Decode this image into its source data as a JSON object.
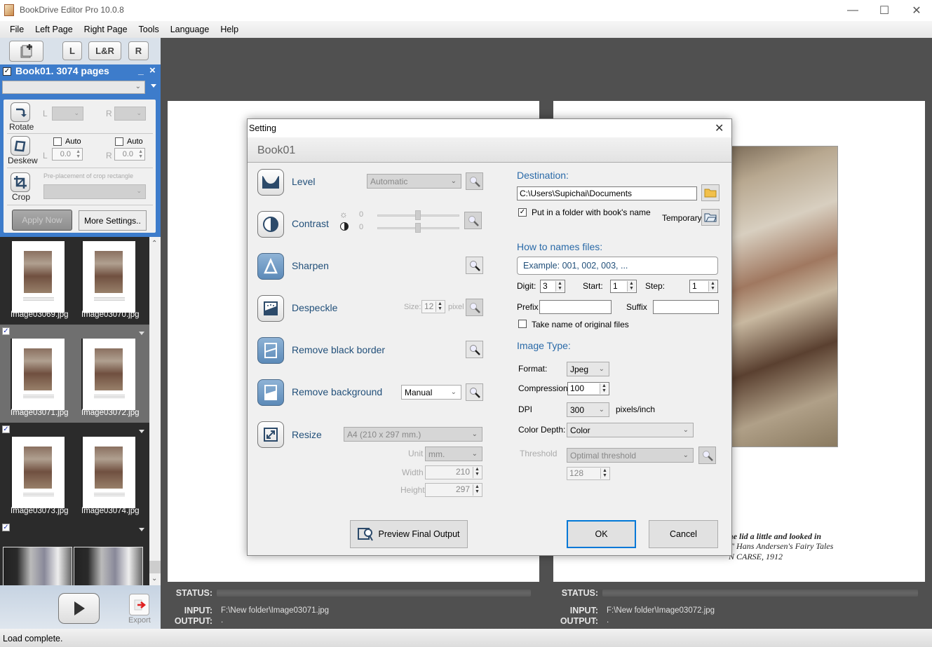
{
  "window": {
    "title": "BookDrive Editor Pro 10.0.8",
    "minimize": "—",
    "maximize": "☐",
    "close": "✕"
  },
  "menu": [
    "File",
    "Left Page",
    "Right Page",
    "Tools",
    "Language",
    "Help"
  ],
  "toolbar": {
    "left_label": "L",
    "both_label": "L&R",
    "right_label": "R"
  },
  "book": {
    "checked": true,
    "title": "Book01. 3074 pages",
    "minimize": "_",
    "close": "×"
  },
  "tools": {
    "rotate": {
      "label": "Rotate",
      "left": "L",
      "right": "R"
    },
    "deskew": {
      "label": "Deskew",
      "auto_left": "Auto",
      "auto_right": "Auto",
      "left": "L",
      "right": "R",
      "left_value": "0.0",
      "right_value": "0.0"
    },
    "crop": {
      "label": "Crop",
      "hint": "Pre-placement of crop rectangle"
    },
    "apply_now": "Apply Now",
    "more_settings": "More Settings.."
  },
  "thumbnails": [
    {
      "checked": true,
      "selected": false,
      "left": "Image03069.jpg",
      "right": "Image03070.jpg"
    },
    {
      "checked": true,
      "selected": true,
      "left": "Image03071.jpg",
      "right": "Image03072.jpg"
    },
    {
      "checked": true,
      "selected": false,
      "left": "Image03073.jpg",
      "right": "Image03074.jpg"
    },
    {
      "checked": true,
      "selected": false,
      "left": "",
      "right": ""
    }
  ],
  "bottom": {
    "export_label": "Export"
  },
  "viewer": {
    "left": {
      "status_label": "STATUS:",
      "input_label": "INPUT:",
      "output_label": "OUTPUT:",
      "input": "F:\\New folder\\Image03071.jpg",
      "output": "."
    },
    "right": {
      "status_label": "STATUS:",
      "input_label": "INPUT:",
      "output_label": "OUTPUT:",
      "input": "F:\\New folder\\Image03072.jpg",
      "output": "."
    },
    "caption": [
      "he lid a little and looked in",
      ",\" Hans Andersen's Fairy Tales",
      "N CARSE, 1912"
    ]
  },
  "statusbar": "Load complete.",
  "dialog": {
    "title": "Setting",
    "header": "Book01",
    "options": {
      "level": {
        "label": "Level",
        "value": "Automatic"
      },
      "contrast": {
        "label": "Contrast",
        "brightness": "0",
        "contrast": "0"
      },
      "sharpen": {
        "label": "Sharpen"
      },
      "despeckle": {
        "label": "Despeckle",
        "size_label": "Size:",
        "size": "12",
        "unit": "pixel"
      },
      "remove_black_border": {
        "label": "Remove black border"
      },
      "remove_background": {
        "label": "Remove background",
        "value": "Manual"
      },
      "resize": {
        "label": "Resize",
        "preset": "A4 (210 x 297 mm.)",
        "unit_label": "Unit",
        "unit": "mm.",
        "width_label": "Width",
        "width": "210",
        "height_label": "Height",
        "height": "297"
      }
    },
    "destination": {
      "label": "Destination:",
      "path": "C:\\Users\\Supichai\\Documents",
      "put_in_folder": "Put in a folder with book's name",
      "put_in_folder_checked": true,
      "temporary": "Temporary"
    },
    "naming": {
      "label": "How to names files:",
      "example": "Example: 001, 002, 003, ...",
      "digit_label": "Digit:",
      "digit": "3",
      "start_label": "Start:",
      "start": "1",
      "step_label": "Step:",
      "step": "1",
      "prefix_label": "Prefix",
      "prefix": "",
      "suffix_label": "Suffix",
      "suffix": "",
      "take_original": "Take name of original files",
      "take_original_checked": false
    },
    "image_type": {
      "label": "Image Type:",
      "format_label": "Format:",
      "format": "Jpeg",
      "compression_label": "Compression:",
      "compression": "100",
      "dpi_label": "DPI",
      "dpi": "300",
      "dpi_unit": "pixels/inch",
      "color_depth_label": "Color Depth:",
      "color_depth": "Color",
      "threshold_label": "Threshold",
      "threshold_mode": "Optimal threshold",
      "threshold": "128"
    },
    "preview_button": "Preview Final Output",
    "ok": "OK",
    "cancel": "Cancel"
  }
}
